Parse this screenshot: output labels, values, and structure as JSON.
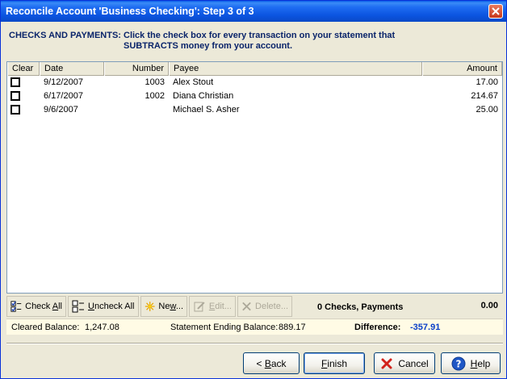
{
  "window": {
    "title": "Reconcile Account 'Business Checking': Step 3 of 3"
  },
  "instructions": {
    "line1": "CHECKS AND PAYMENTS: Click the check box for every transaction on your statement that",
    "line2": "SUBTRACTS money from your account."
  },
  "table": {
    "columns": {
      "clear": "Clear",
      "date": "Date",
      "number": "Number",
      "payee": "Payee",
      "amount": "Amount"
    },
    "rows": [
      {
        "checked": false,
        "date": "9/12/2007",
        "number": "1003",
        "payee": "Alex Stout",
        "amount": "17.00"
      },
      {
        "checked": false,
        "date": "6/17/2007",
        "number": "1002",
        "payee": "Diana Christian",
        "amount": "214.67"
      },
      {
        "checked": false,
        "date": "9/6/2007",
        "number": "",
        "payee": "Michael S. Asher",
        "amount": "25.00"
      }
    ]
  },
  "toolbar": {
    "check_all": {
      "pre": "Check ",
      "u": "A",
      "post": "ll"
    },
    "uncheck_all": {
      "pre": "",
      "u": "U",
      "post": "ncheck All"
    },
    "new": {
      "pre": "Ne",
      "u": "w",
      "post": "..."
    },
    "edit": {
      "pre": "",
      "u": "E",
      "post": "dit..."
    },
    "delete": {
      "pre": "Delete...",
      "u": "",
      "post": ""
    },
    "summary_label": "0 Checks, Payments",
    "summary_total": "0.00"
  },
  "balances": {
    "cleared_label": "Cleared Balance:",
    "cleared_value": "1,247.08",
    "statement_label": "Statement Ending Balance:",
    "statement_value": "889.17",
    "difference_label": "Difference:",
    "difference_value": "-357.91",
    "difference_color": "#0a3fc8"
  },
  "buttons": {
    "back": {
      "pre": "< ",
      "u": "B",
      "post": "ack"
    },
    "finish": {
      "pre": "",
      "u": "F",
      "post": "inish"
    },
    "cancel": {
      "pre": "Cancel",
      "u": "",
      "post": ""
    },
    "help": {
      "pre": "",
      "u": "H",
      "post": "elp"
    }
  },
  "colors": {
    "title_bar": "#0a54e0",
    "instruction_text": "#0a246a",
    "cancel_icon": "#d2221b",
    "help_icon": "#1f57c6"
  }
}
